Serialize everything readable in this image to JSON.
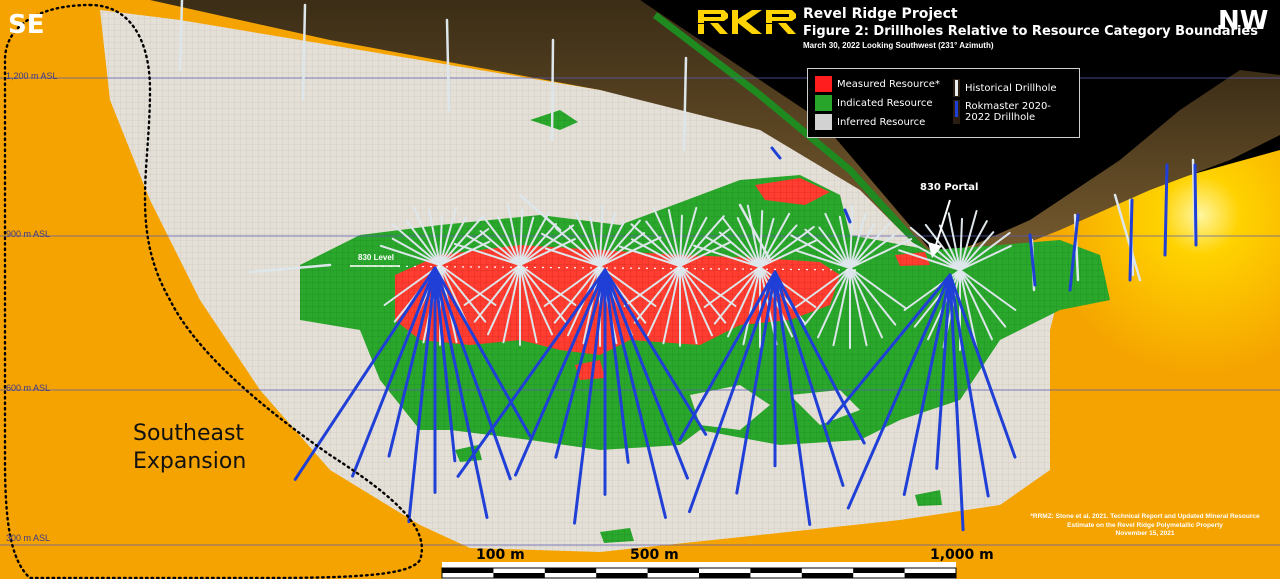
{
  "header": {
    "corner_left": "SE",
    "corner_right": "NW",
    "project_title": "Revel Ridge Project",
    "figure_title": "Figure 2: Drillholes Relative to Resource Category Boundaries",
    "date_view": "March 30, 2022   Looking Southwest (231° Azimuth)",
    "logo_text": "RKR"
  },
  "legend": {
    "items": [
      {
        "label": "Measured Resource*",
        "color": "#ff1d1d"
      },
      {
        "label": "Indicated Resource",
        "color": "#26a52a"
      },
      {
        "label": "Inferred Resource",
        "color": "#d2d2d2"
      },
      {
        "label": "Historical Drillhole",
        "color": "#e8ecef"
      },
      {
        "label": "Rokmaster 2020-2022 Drillhole",
        "color": "#1f3fd6"
      }
    ]
  },
  "elevations": [
    "1,200 m ASL",
    "900 m ASL",
    "600 m ASL",
    "300 m ASL"
  ],
  "annotations": {
    "portal": "830 Portal",
    "level": "830 Level",
    "region_line1": "Southeast",
    "region_line2": "Expansion"
  },
  "reference": {
    "line1": "*RRMZ: Stone et al. 2021. Technical Report and Updated Mineral Resource",
    "line2": "Estimate on the Revel Ridge Polymetallic Property",
    "line3": "November 15, 2021"
  },
  "scale_bar": {
    "labels": [
      "100 m",
      "500 m",
      "1,000 m"
    ]
  },
  "colors": {
    "background": "#000000",
    "orange_zone": "#f5a300",
    "inferred": "#dedad2",
    "indicated": "#26a52a",
    "measured": "#ff3b30",
    "terrain": "#5e4824",
    "historical_drillhole": "#dde6ea",
    "rokmaster_drillhole": "#1f3fd6"
  }
}
